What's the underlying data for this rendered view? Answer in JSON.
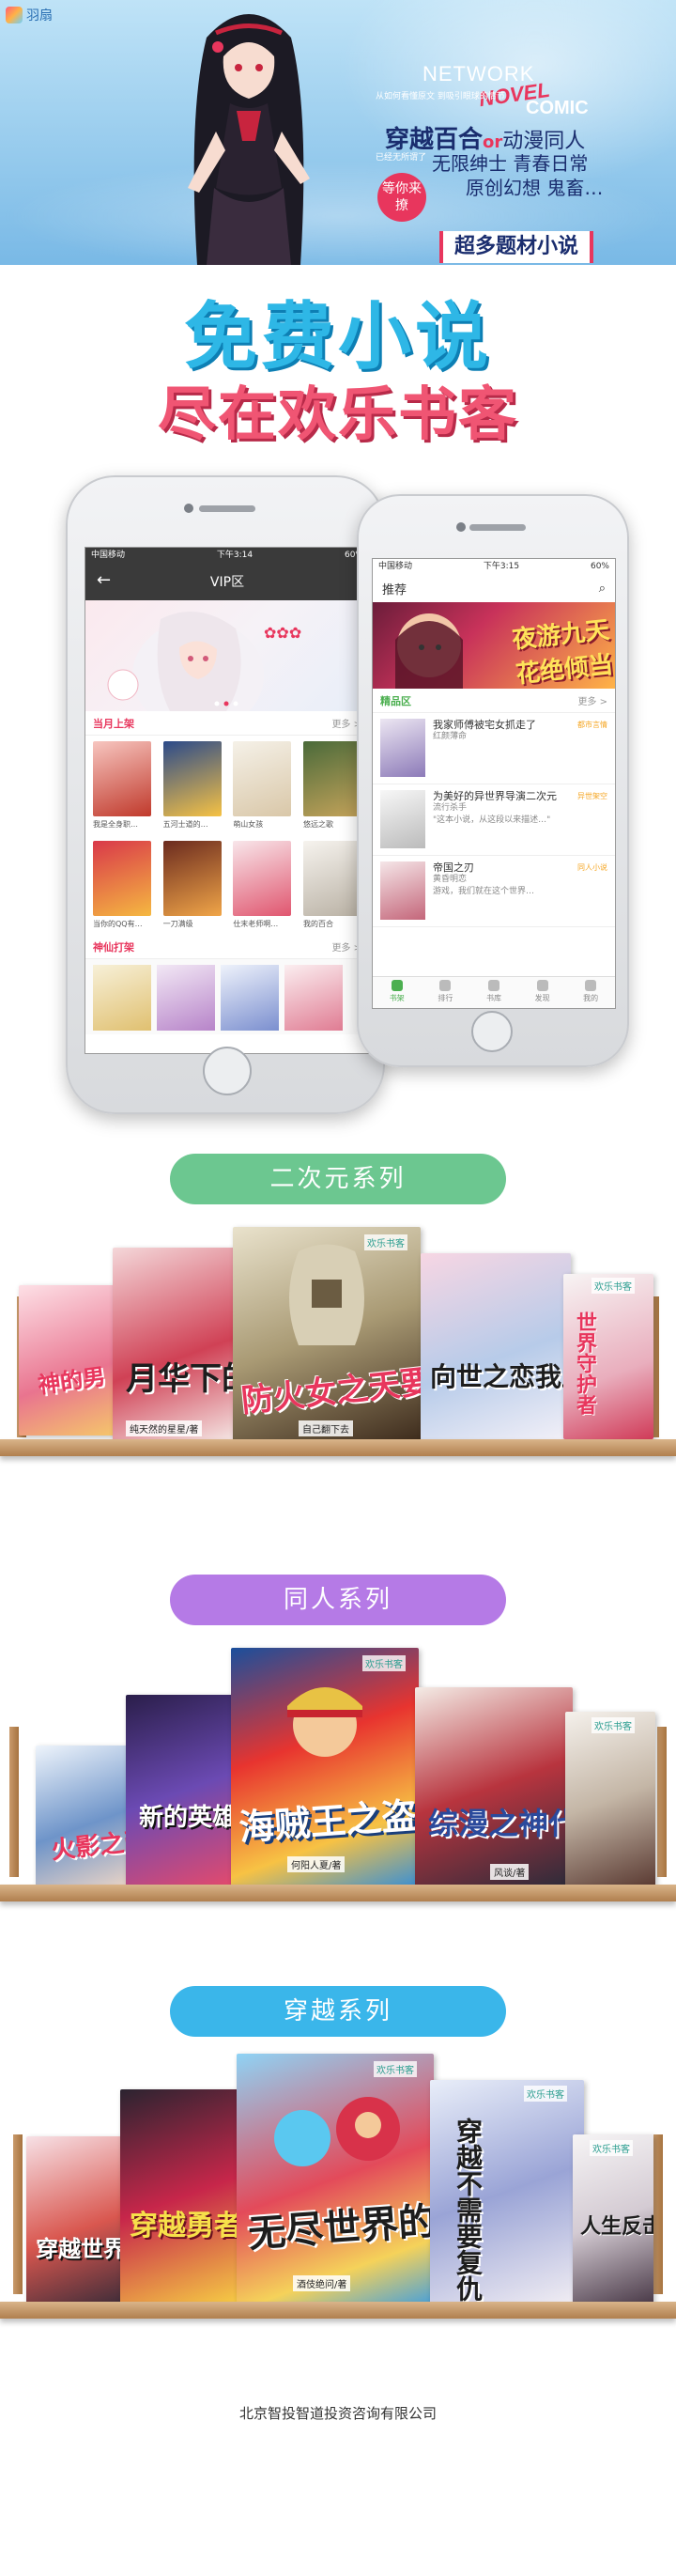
{
  "banner": {
    "logo_text": "羽扇",
    "network": "NETWORK",
    "novel": "NOVEL",
    "comic": "COMIC",
    "small_text": "从如何看懂原文 到吸引眼球的情节",
    "line1_main": "穿越百合",
    "line1_or": "or",
    "line1_tail": "动漫同人",
    "sub_text": "已经无所谓了",
    "line2": "无限绅士 青春日常",
    "line3": "原创幻想 鬼畜…",
    "badge": "等你来撩",
    "bar": "超多题材小说"
  },
  "slogan": {
    "line1": "免费小说",
    "line2": "尽在欢乐书客"
  },
  "phone_left": {
    "carrier": "中国移动",
    "time": "下午3:14",
    "battery": "60%",
    "title": "VIP区",
    "section1_title": "当月上架",
    "section1_more": "更多 >",
    "row1": [
      "我是全身职…",
      "五河士道的…",
      "萌山女孩",
      "悠远之歌"
    ],
    "row2": [
      "当你的QQ有…",
      "一刀满级",
      "仕末老师啊…",
      "我的百合"
    ],
    "section2_title": "神仙打架",
    "section2_more": "更多 >"
  },
  "phone_right": {
    "carrier": "中国移动",
    "time": "下午3:15",
    "battery": "60%",
    "title": "推荐",
    "hero_text": "夜游九天 花绝倾当",
    "section_title": "精品区",
    "section_more": "更多 >",
    "books": [
      {
        "title": "我家师傅被宅女抓走了",
        "tag": "都市言情",
        "author": "红颜薄命",
        "desc": ""
      },
      {
        "title": "为美好的异世界导演二次元",
        "tag": "异世架空",
        "author": "流行杀手",
        "desc": "\"这本小说，从这段以来描述…\""
      },
      {
        "title": "帝国之刃",
        "tag": "同人小说",
        "author": "黄昏明恋",
        "desc": "游戏，我们就在这个世界…"
      }
    ],
    "tabs": [
      "书架",
      "排行",
      "书库",
      "发现",
      "我的"
    ]
  },
  "series": [
    {
      "name": "二次元系列",
      "color": "#6cc790"
    },
    {
      "name": "同人系列",
      "color": "#b57ae6"
    },
    {
      "name": "穿越系列",
      "color": "#3ab6ea"
    }
  ],
  "shelf1": [
    {
      "title": "神的男",
      "author": "",
      "pub": ""
    },
    {
      "title": "月华下的约会",
      "author": "纯天然的星星/著",
      "pub": ""
    },
    {
      "title": "防火女之天要打死你",
      "author": "自己翻下去",
      "pub": "欢乐书客"
    },
    {
      "title": "向世之恋我上门",
      "author": "",
      "pub": ""
    },
    {
      "title": "世界守护者",
      "author": "",
      "pub": "欢乐书客"
    }
  ],
  "shelf2": [
    {
      "title": "火影之画",
      "author": "",
      "pub": ""
    },
    {
      "title": "新的英雄联盟",
      "author": "",
      "pub": ""
    },
    {
      "title": "海贼王之盗贼医者",
      "author": "何阳人夏/著",
      "pub": "欢乐书客"
    },
    {
      "title": "综漫之神代海贼",
      "author": "风谈/著",
      "pub": ""
    },
    {
      "title": "",
      "author": "",
      "pub": "欢乐书客"
    }
  ],
  "shelf3": [
    {
      "title": "穿越世界",
      "author": "",
      "pub": ""
    },
    {
      "title": "穿越勇者的异界记",
      "author": "",
      "pub": ""
    },
    {
      "title": "无尽世界的怪兽",
      "author": "酒伎绝问/著",
      "pub": "欢乐书客"
    },
    {
      "title": "穿越不需要复仇",
      "author": "",
      "pub": "欢乐书客"
    },
    {
      "title": "人生反击",
      "author": "",
      "pub": "欢乐书客"
    }
  ],
  "footer": "北京智投智道投资咨询有限公司"
}
